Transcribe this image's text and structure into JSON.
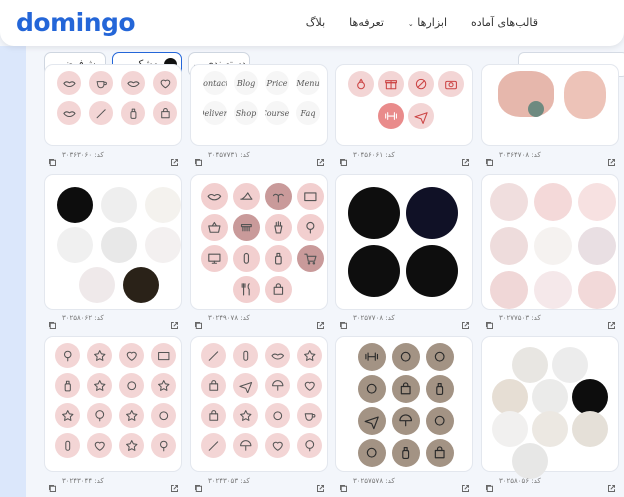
{
  "header": {
    "logo": "domingo",
    "nav": [
      "قالب‌های آماده",
      "ابزارها",
      "تعرفه‌ها",
      "بلاگ"
    ]
  },
  "filters": {
    "default_label": "پیش‌فرض",
    "color_label": "مشکی",
    "category_label": "دسته‌بندی",
    "color_value": "#111111"
  },
  "cards": [
    {
      "code": "کد: ۳۰۳۶۳۰۶۰",
      "icons": [
        "lipstick",
        "cup",
        "lips",
        "lips2",
        "lips3",
        "brush",
        "bottle",
        "bag"
      ]
    },
    {
      "code": "کد: ۳۰۴۵۷۷۳۱",
      "icons": [
        "Contacts",
        "Blog",
        "Price",
        "Menu",
        "Delivery",
        "Shop",
        "Courses",
        "Faq"
      ]
    },
    {
      "code": "کد: ۳۰۴۵۶۰۶۱",
      "icons": [
        "ring",
        "gift",
        "noevent",
        "camera",
        "dumbbell",
        "plane"
      ]
    },
    {
      "code": "کد: ۳۰۳۶۴۷۰۸",
      "icons": [
        "collage"
      ]
    },
    {
      "code": "کد: ۳۰۲۵۸۰۶۲",
      "icons": [
        "marble"
      ]
    },
    {
      "code": "کد: ۳۰۲۴۹۰۷۸",
      "icons": [
        "lips",
        "heel",
        "palm",
        "tv",
        "basket",
        "comb",
        "fries",
        "mirror",
        "screen",
        "nail",
        "bottle",
        "cart",
        "cutlery",
        "bag"
      ]
    },
    {
      "code": "کد: ۳۰۲۵۷۷۰۸",
      "icons": [
        "blackmarble"
      ]
    },
    {
      "code": "کد: ۳۰۲۷۷۵۰۳",
      "icons": [
        "fashion"
      ]
    },
    {
      "code": "کد: ۳۰۲۴۳۰۴۴",
      "icons": [
        "pink"
      ]
    },
    {
      "code": "کد: ۳۰۲۴۳۰۵۳",
      "icons": [
        "pink2"
      ]
    },
    {
      "code": "کد: ۳۰۲۵۷۵۷۸",
      "icons": [
        "metal"
      ]
    },
    {
      "code": "کد: ۳۰۲۵۸۰۵۶",
      "icons": [
        "marble2"
      ]
    }
  ],
  "colors": {
    "accent": "#2466d8",
    "pink": "#f3d5d5",
    "dark": "#141414"
  }
}
